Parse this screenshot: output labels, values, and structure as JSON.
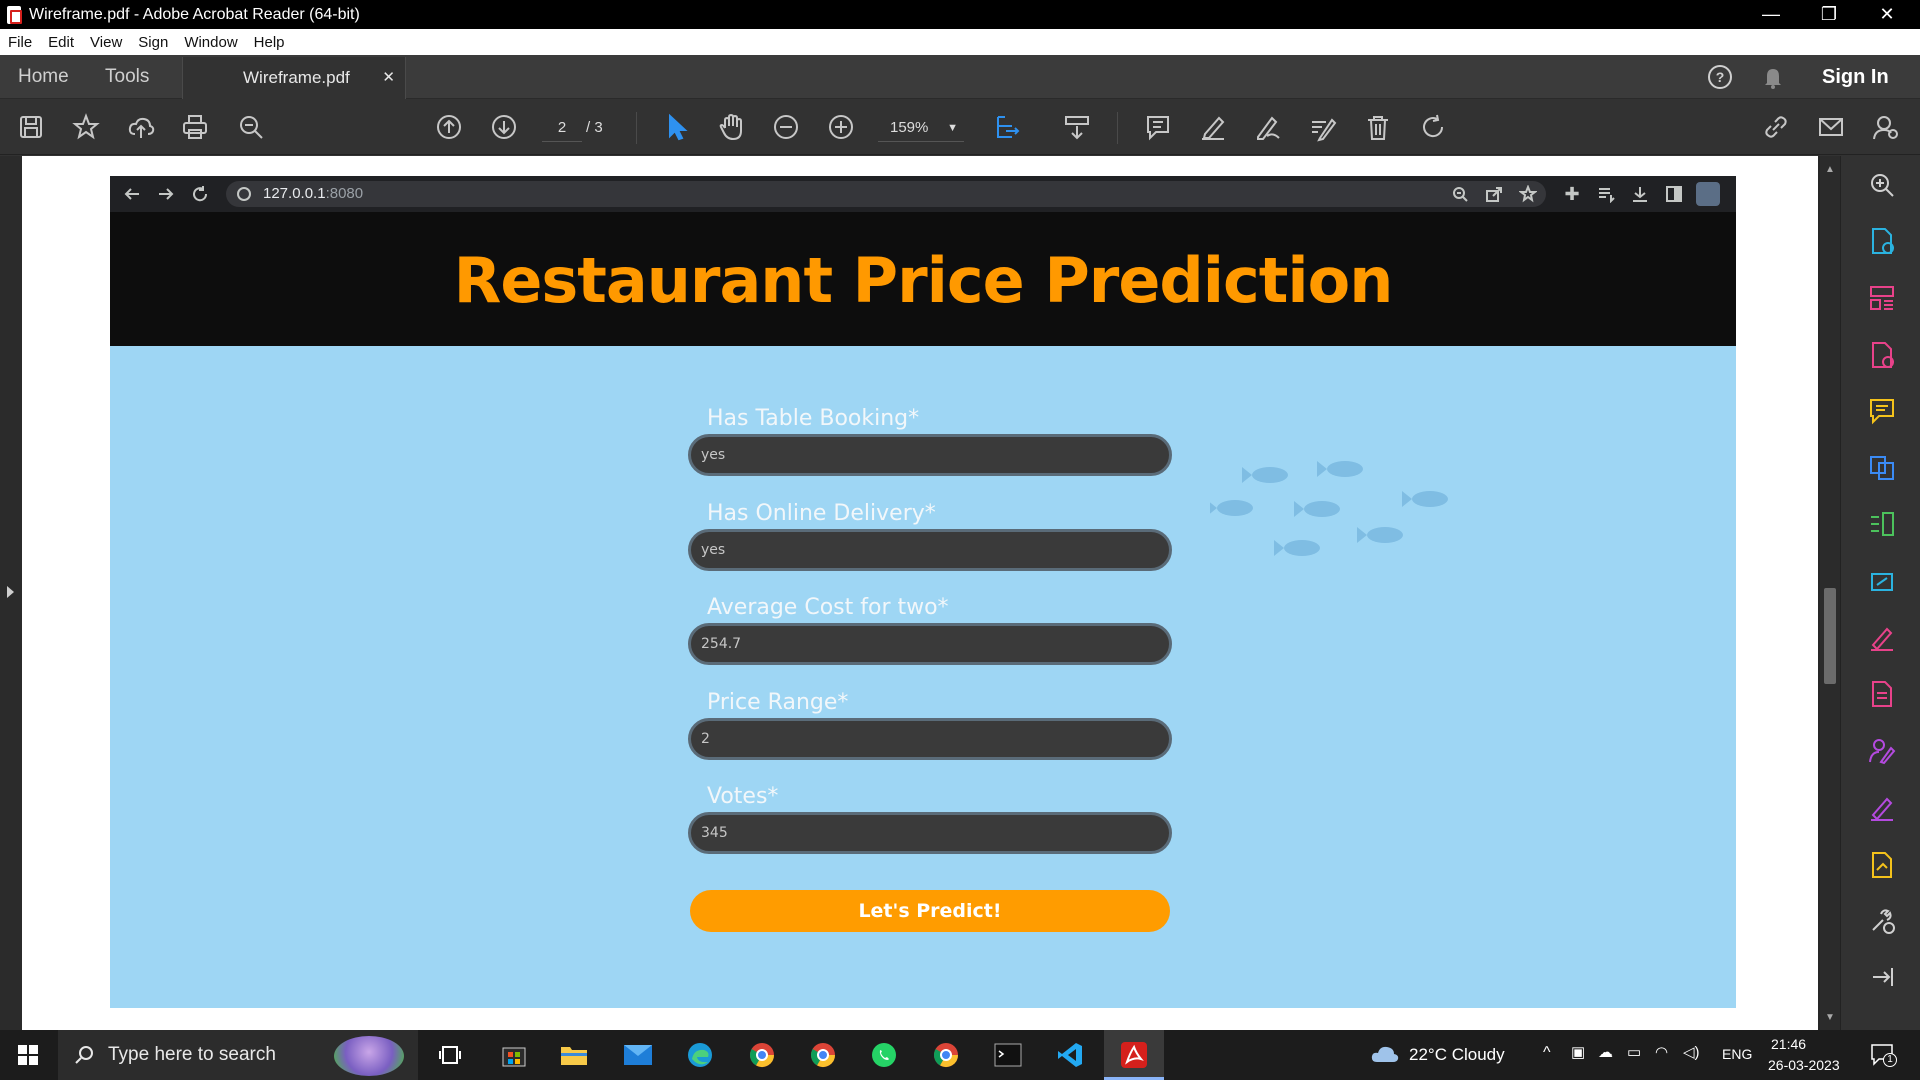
{
  "window": {
    "title": "Wireframe.pdf - Adobe Acrobat Reader (64-bit)"
  },
  "menu": [
    "File",
    "Edit",
    "View",
    "Sign",
    "Window",
    "Help"
  ],
  "nav": {
    "home": "Home",
    "tools": "Tools",
    "doc_tab": "Wireframe.pdf",
    "sign_in": "Sign In"
  },
  "toolbar": {
    "page_current": "2",
    "page_total": "/ 3",
    "zoom": "159%"
  },
  "browser": {
    "url_host": "127.0.0.1",
    "url_port": ":8080"
  },
  "app": {
    "title": "Restaurant Price Prediction",
    "fields": [
      {
        "label": "Has Table Booking*",
        "value": "yes"
      },
      {
        "label": "Has Online Delivery*",
        "value": "yes"
      },
      {
        "label": "Average Cost for two*",
        "value": "254.7"
      },
      {
        "label": "Price Range*",
        "value": "2"
      },
      {
        "label": "Votes*",
        "value": "345"
      }
    ],
    "submit": "Let's Predict!"
  },
  "taskbar": {
    "search_placeholder": "Type here to search",
    "weather": "22°C  Cloudy",
    "lang": "ENG",
    "time": "21:46",
    "date": "26-03-2023",
    "notif_count": "1"
  },
  "colors": {
    "accent_orange": "#ff9900",
    "form_bg": "#9ed6f4",
    "header_bg": "#0d0d0d"
  }
}
